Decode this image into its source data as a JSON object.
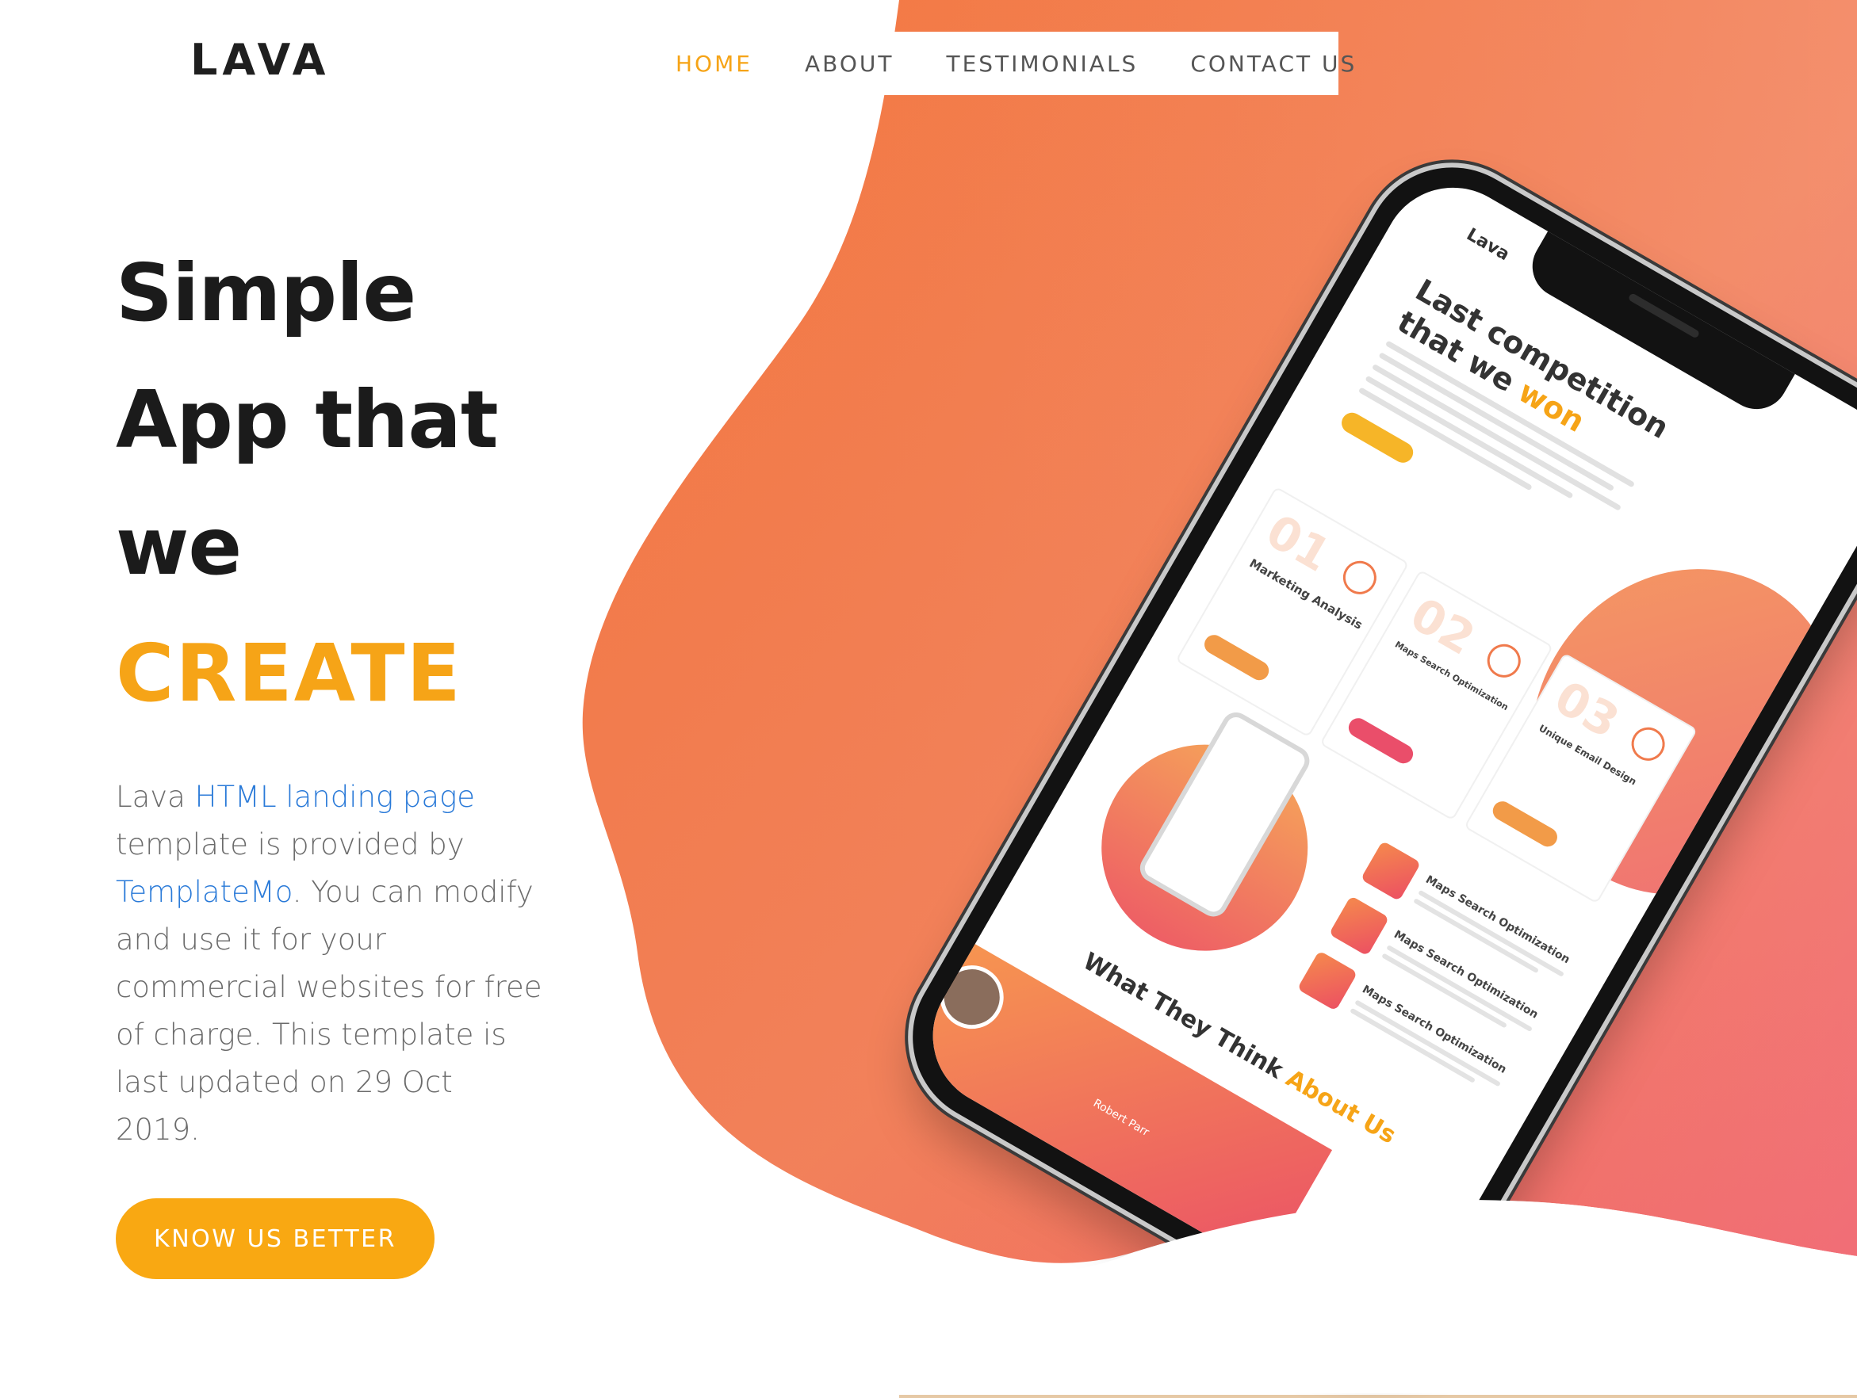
{
  "header": {
    "logo": "LAVA",
    "nav": [
      {
        "label": "HOME",
        "active": true
      },
      {
        "label": "ABOUT",
        "active": false
      },
      {
        "label": "TESTIMONIALS",
        "active": false
      },
      {
        "label": "CONTACT US",
        "active": false
      }
    ]
  },
  "hero": {
    "headline_line1": "Simple",
    "headline_line2": "App that",
    "headline_line3": "we",
    "headline_accent": "CREATE",
    "description": {
      "part1": "Lava ",
      "link1": "HTML landing page",
      "part2": " template is provided by ",
      "link2": "TemplateMo",
      "part3": ". You can modify and use it for your commercial websites for free of charge. This template is last updated on 29 Oct 2019."
    },
    "cta_label": "KNOW US BETTER"
  },
  "phone_screen": {
    "logo": "Lava",
    "title_line1": "Last competition",
    "title_line2_prefix": "that we ",
    "title_won": "won",
    "cards": [
      {
        "num": "01",
        "title": "Marketing Analysis"
      },
      {
        "num": "02",
        "title": "Maps Search Optimization"
      },
      {
        "num": "03",
        "title": "Unique Email Design"
      }
    ],
    "features": [
      {
        "title": "Maps Search Optimization"
      },
      {
        "title": "Maps Search Optimization"
      },
      {
        "title": "Maps Search Optimization"
      }
    ],
    "think_prefix": "What They Think ",
    "think_about": "About Us",
    "testimonial_name": "Robert Parr"
  },
  "colors": {
    "accent": "#f6a417",
    "link": "#2a7ad8",
    "gradient_start": "#f38a45",
    "gradient_end": "#ef5d64"
  }
}
